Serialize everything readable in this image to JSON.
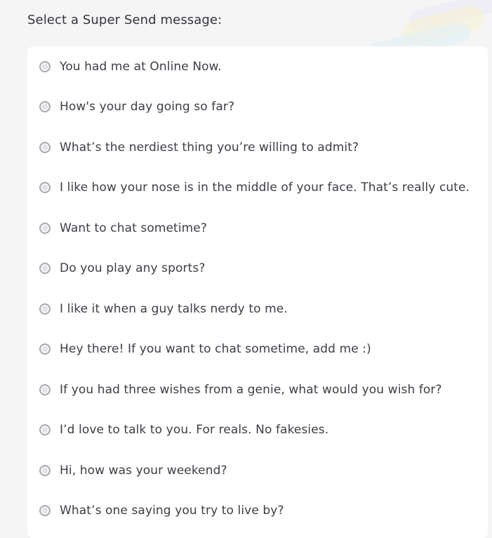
{
  "header": {
    "title": "Select a Super Send message:"
  },
  "options": [
    {
      "label": "You had me at Online Now."
    },
    {
      "label": "How's your day going so far?"
    },
    {
      "label": "What’s the nerdiest thing you’re willing to admit?"
    },
    {
      "label": "I like how your nose is in the middle of your face. That’s really cute."
    },
    {
      "label": "Want to chat sometime?"
    },
    {
      "label": "Do you play any sports?"
    },
    {
      "label": "I like it when a guy talks nerdy to me."
    },
    {
      "label": "Hey there! If you want to chat sometime, add me :)"
    },
    {
      "label": "If you had three wishes from a genie, what would you wish for?"
    },
    {
      "label": "I’d love to talk to you. For reals. No fakesies."
    },
    {
      "label": "Hi, how was your weekend?"
    },
    {
      "label": "What’s one saying you try to live by?"
    }
  ],
  "colors": {
    "background": "#f5f5f6",
    "card": "#ffffff",
    "text": "#3d3d45",
    "radio_border": "#a9aaae"
  }
}
